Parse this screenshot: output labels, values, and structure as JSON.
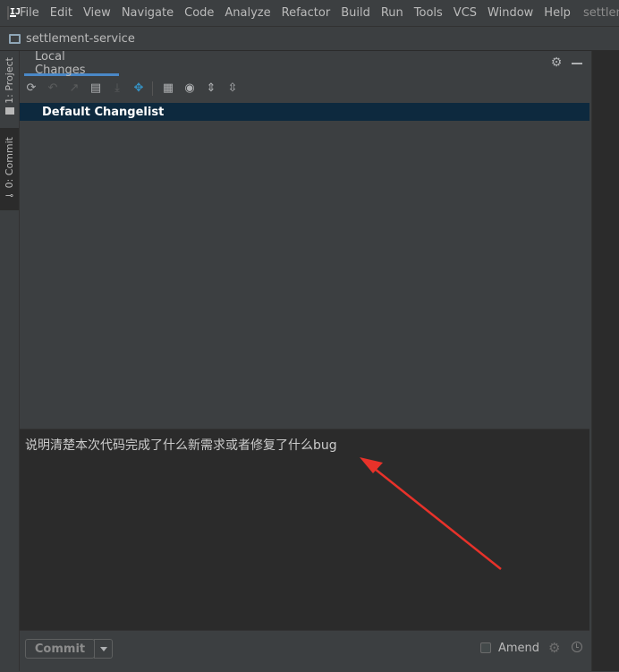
{
  "menubar": {
    "logo_text": "IJ",
    "items": [
      "File",
      "Edit",
      "View",
      "Navigate",
      "Code",
      "Analyze",
      "Refactor",
      "Build",
      "Run",
      "Tools",
      "VCS",
      "Window",
      "Help"
    ],
    "window_title": "settlement"
  },
  "navbar": {
    "project": "settlement-service"
  },
  "left_strip": {
    "project_tab": "1: Project",
    "commit_tab": "0: Commit"
  },
  "panel": {
    "tab": "Local Changes",
    "changelist": "Default Changelist",
    "commit_message": "说明清楚本次代码完成了什么新需求或者修复了什么bug"
  },
  "bottom": {
    "commit_label": "Commit",
    "amend_label": "Amend",
    "amend_checked": false
  },
  "colors": {
    "background": "#3c3f41",
    "editor": "#2b2b2b",
    "selection": "#0d293e",
    "tab_underline": "#4a88c7",
    "annotation_arrow": "#e8322a"
  }
}
